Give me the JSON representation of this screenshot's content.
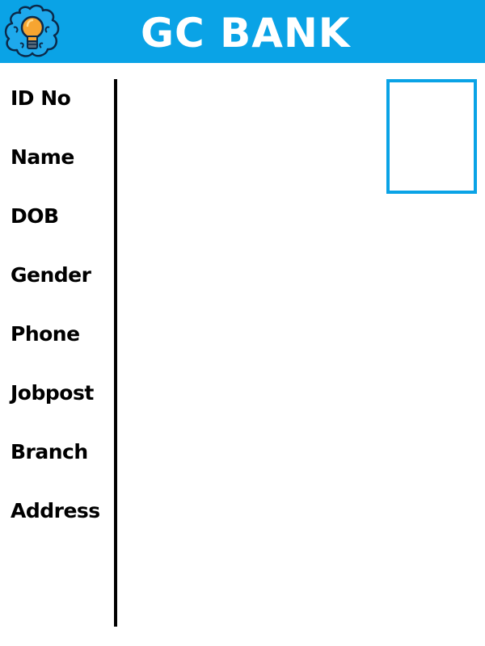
{
  "header": {
    "title": "GC BANK",
    "logo_icon": "lightbulb-brain-icon",
    "background_color": "#0aa3e6"
  },
  "fields": [
    {
      "label": "ID No"
    },
    {
      "label": "Name"
    },
    {
      "label": "DOB"
    },
    {
      "label": "Gender"
    },
    {
      "label": "Phone"
    },
    {
      "label": "Jobpost"
    },
    {
      "label": "Branch"
    },
    {
      "label": "Address"
    }
  ],
  "photo": {
    "icon": "photo-placeholder",
    "border_color": "#0aa3e6"
  }
}
